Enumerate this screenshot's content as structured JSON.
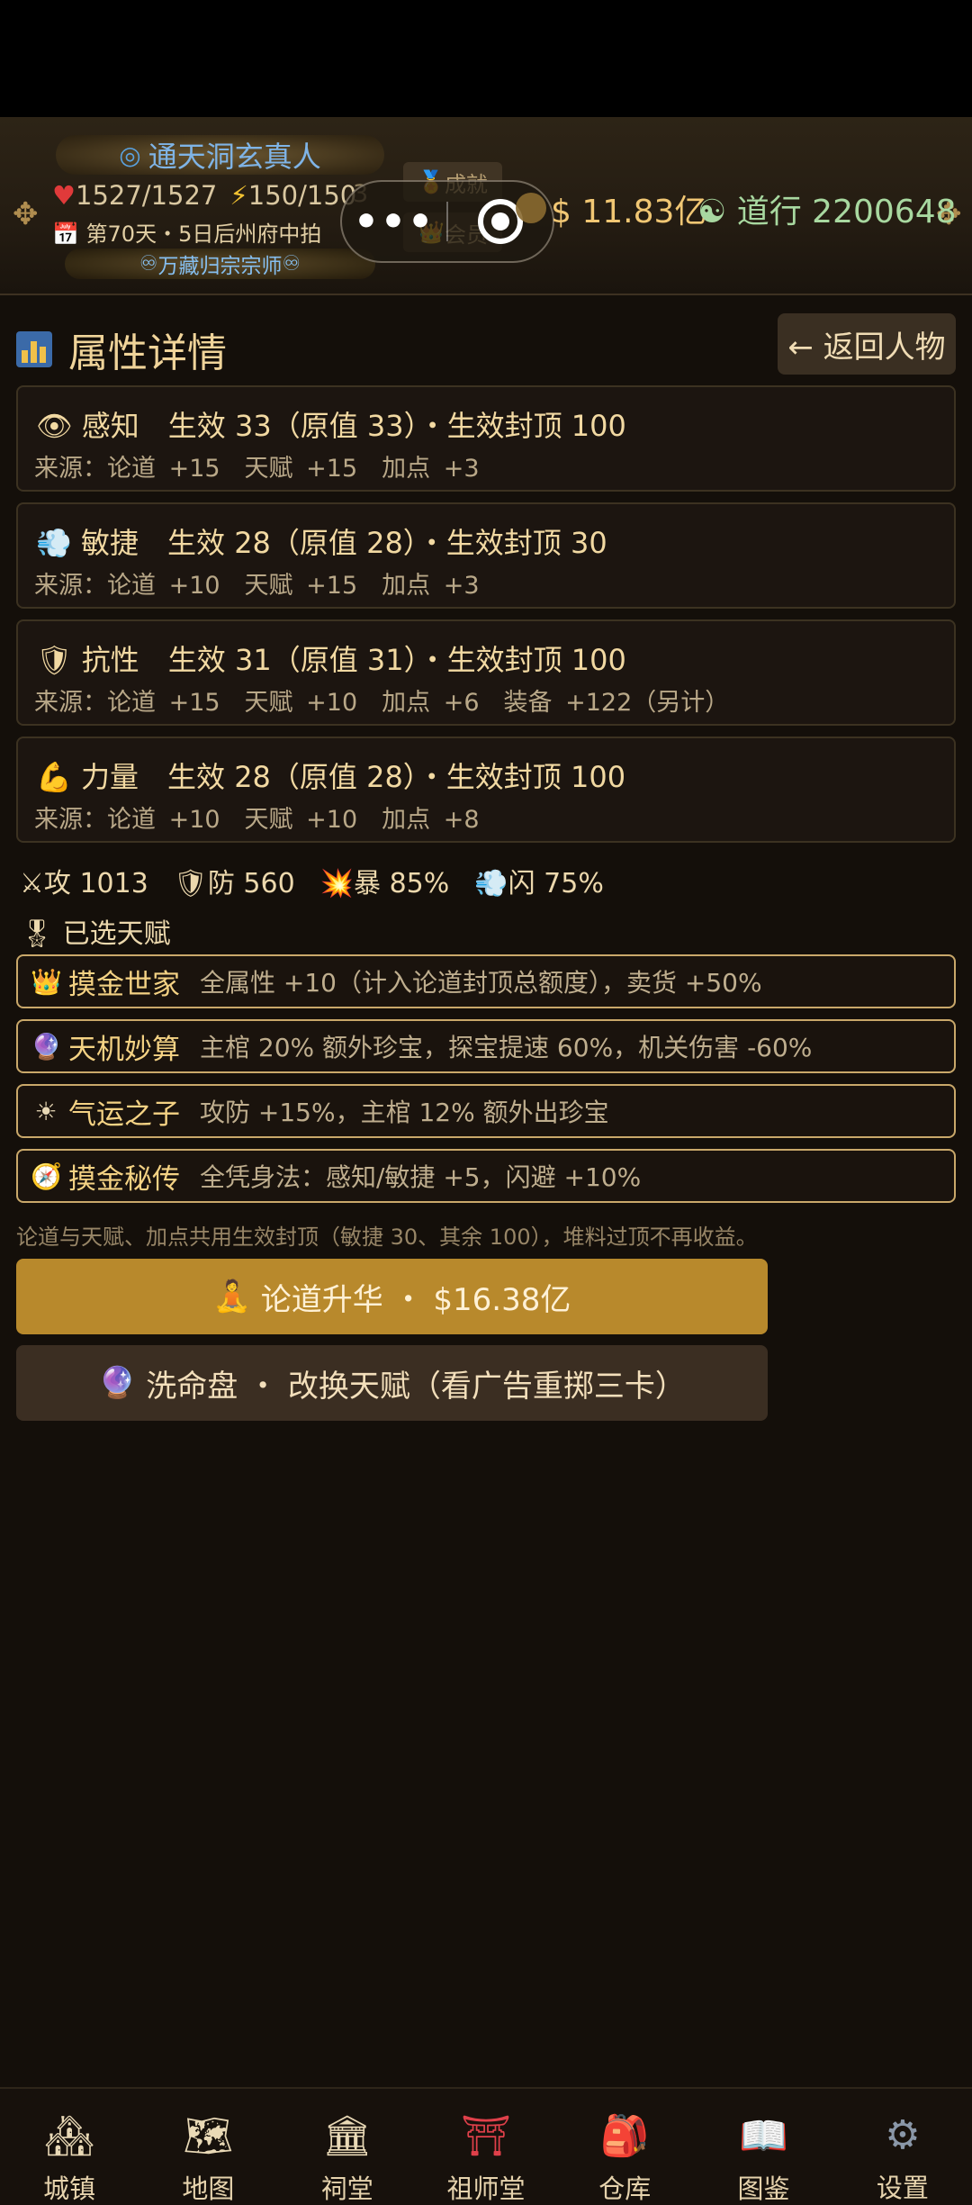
{
  "header": {
    "player_title": "通天洞玄真人",
    "hp": "1527/1527",
    "energy": "150/150",
    "level_badge": "3",
    "day_info": "第70天・5日后州府中拍",
    "sect_title": "万藏归宗宗师",
    "achievements_label": "成就",
    "vip_label": "会员",
    "money": "$ 11.83亿",
    "daoxing": "道行 2200648"
  },
  "page": {
    "title": "属性详情",
    "back_label": "← 返回人物"
  },
  "attributes": [
    {
      "icon": "eye-icon",
      "line1": "感知　生效 33（原值 33）・生效封顶 100",
      "line2": "来源：论道 +15　天赋 +15　加点 +3"
    },
    {
      "icon": "wind-icon",
      "line1": "敏捷　生效 28（原值 28）・生效封顶 30",
      "line2": "来源：论道 +10　天赋 +15　加点 +3"
    },
    {
      "icon": "shield-icon",
      "line1": "抗性　生效 31（原值 31）・生效封顶 100",
      "line2": "来源：论道 +15　天赋 +10　加点 +6　装备 +122（另计）"
    },
    {
      "icon": "muscle-icon",
      "line1": "力量　生效 28（原值 28）・生效封顶 100",
      "line2": "来源：论道 +10　天赋 +10　加点 +8"
    }
  ],
  "combat": {
    "attack": "攻 1013",
    "defense": "防 560",
    "crit": "暴 85%",
    "dodge": "闪 75%"
  },
  "talents_heading": "已选天赋",
  "talents": [
    {
      "icon": "crown-icon",
      "name": "摸金世家",
      "desc": "全属性 +10（计入论道封顶总额度），卖货 +50%"
    },
    {
      "icon": "crystal-ball-icon",
      "name": "天机妙算",
      "desc": "主棺 20% 额外珍宝，探宝提速 60%，机关伤害 -60%"
    },
    {
      "icon": "sun-icon",
      "name": "气运之子",
      "desc": "攻防 +15%，主棺 12% 额外出珍宝"
    },
    {
      "icon": "compass-icon",
      "name": "摸金秘传",
      "desc": "全凭身法：感知/敏捷 +5，闪避 +10%"
    }
  ],
  "note": "论道与天赋、加点共用生效封顶（敏捷 30、其余 100），堆料过顶不再收益。",
  "actions": {
    "upgrade_label": "论道升华 ・ $16.38亿",
    "wash_label": "洗命盘 ・ 改换天赋（看广告重掷三卡）"
  },
  "tabs": [
    {
      "label": "城镇",
      "icon": "town-icon"
    },
    {
      "label": "地图",
      "icon": "map-icon"
    },
    {
      "label": "祠堂",
      "icon": "temple-icon"
    },
    {
      "label": "祖师堂",
      "icon": "torii-icon"
    },
    {
      "label": "仓库",
      "icon": "backpack-icon"
    },
    {
      "label": "图鉴",
      "icon": "book-icon"
    },
    {
      "label": "设置",
      "icon": "gear-icon"
    }
  ]
}
